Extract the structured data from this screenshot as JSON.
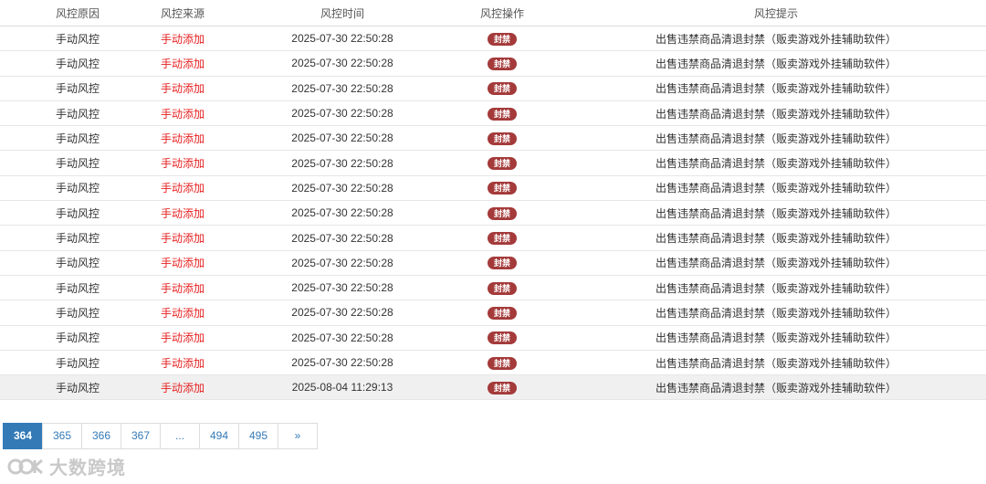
{
  "columns": [
    "风控原因",
    "风控来源",
    "风控时间",
    "风控操作",
    "风控提示"
  ],
  "rows": [
    {
      "reason": "手动风控",
      "source": "手动添加",
      "time": "2025-07-30 22:50:28",
      "action": "封禁",
      "hint": "出售违禁商品清退封禁（贩卖游戏外挂辅助软件）"
    },
    {
      "reason": "手动风控",
      "source": "手动添加",
      "time": "2025-07-30 22:50:28",
      "action": "封禁",
      "hint": "出售违禁商品清退封禁（贩卖游戏外挂辅助软件）"
    },
    {
      "reason": "手动风控",
      "source": "手动添加",
      "time": "2025-07-30 22:50:28",
      "action": "封禁",
      "hint": "出售违禁商品清退封禁（贩卖游戏外挂辅助软件）"
    },
    {
      "reason": "手动风控",
      "source": "手动添加",
      "time": "2025-07-30 22:50:28",
      "action": "封禁",
      "hint": "出售违禁商品清退封禁（贩卖游戏外挂辅助软件）"
    },
    {
      "reason": "手动风控",
      "source": "手动添加",
      "time": "2025-07-30 22:50:28",
      "action": "封禁",
      "hint": "出售违禁商品清退封禁（贩卖游戏外挂辅助软件）"
    },
    {
      "reason": "手动风控",
      "source": "手动添加",
      "time": "2025-07-30 22:50:28",
      "action": "封禁",
      "hint": "出售违禁商品清退封禁（贩卖游戏外挂辅助软件）"
    },
    {
      "reason": "手动风控",
      "source": "手动添加",
      "time": "2025-07-30 22:50:28",
      "action": "封禁",
      "hint": "出售违禁商品清退封禁（贩卖游戏外挂辅助软件）"
    },
    {
      "reason": "手动风控",
      "source": "手动添加",
      "time": "2025-07-30 22:50:28",
      "action": "封禁",
      "hint": "出售违禁商品清退封禁（贩卖游戏外挂辅助软件）"
    },
    {
      "reason": "手动风控",
      "source": "手动添加",
      "time": "2025-07-30 22:50:28",
      "action": "封禁",
      "hint": "出售违禁商品清退封禁（贩卖游戏外挂辅助软件）"
    },
    {
      "reason": "手动风控",
      "source": "手动添加",
      "time": "2025-07-30 22:50:28",
      "action": "封禁",
      "hint": "出售违禁商品清退封禁（贩卖游戏外挂辅助软件）"
    },
    {
      "reason": "手动风控",
      "source": "手动添加",
      "time": "2025-07-30 22:50:28",
      "action": "封禁",
      "hint": "出售违禁商品清退封禁（贩卖游戏外挂辅助软件）"
    },
    {
      "reason": "手动风控",
      "source": "手动添加",
      "time": "2025-07-30 22:50:28",
      "action": "封禁",
      "hint": "出售违禁商品清退封禁（贩卖游戏外挂辅助软件）"
    },
    {
      "reason": "手动风控",
      "source": "手动添加",
      "time": "2025-07-30 22:50:28",
      "action": "封禁",
      "hint": "出售违禁商品清退封禁（贩卖游戏外挂辅助软件）"
    },
    {
      "reason": "手动风控",
      "source": "手动添加",
      "time": "2025-07-30 22:50:28",
      "action": "封禁",
      "hint": "出售违禁商品清退封禁（贩卖游戏外挂辅助软件）"
    },
    {
      "reason": "手动风控",
      "source": "手动添加",
      "time": "2025-08-04 11:29:13",
      "action": "封禁",
      "hint": "出售违禁商品清退封禁（贩卖游戏外挂辅助软件）"
    }
  ],
  "highlighted_row_index": 14,
  "pagination": {
    "pages": [
      "364",
      "365",
      "366",
      "367",
      "...",
      "494",
      "495",
      "»"
    ],
    "active": "364"
  },
  "watermark": {
    "text": "大数跨境",
    "icon": "brand-logo-icon"
  },
  "colors": {
    "source_text": "#e62020",
    "badge": "#a43a3a",
    "pager_active": "#337ab7"
  }
}
